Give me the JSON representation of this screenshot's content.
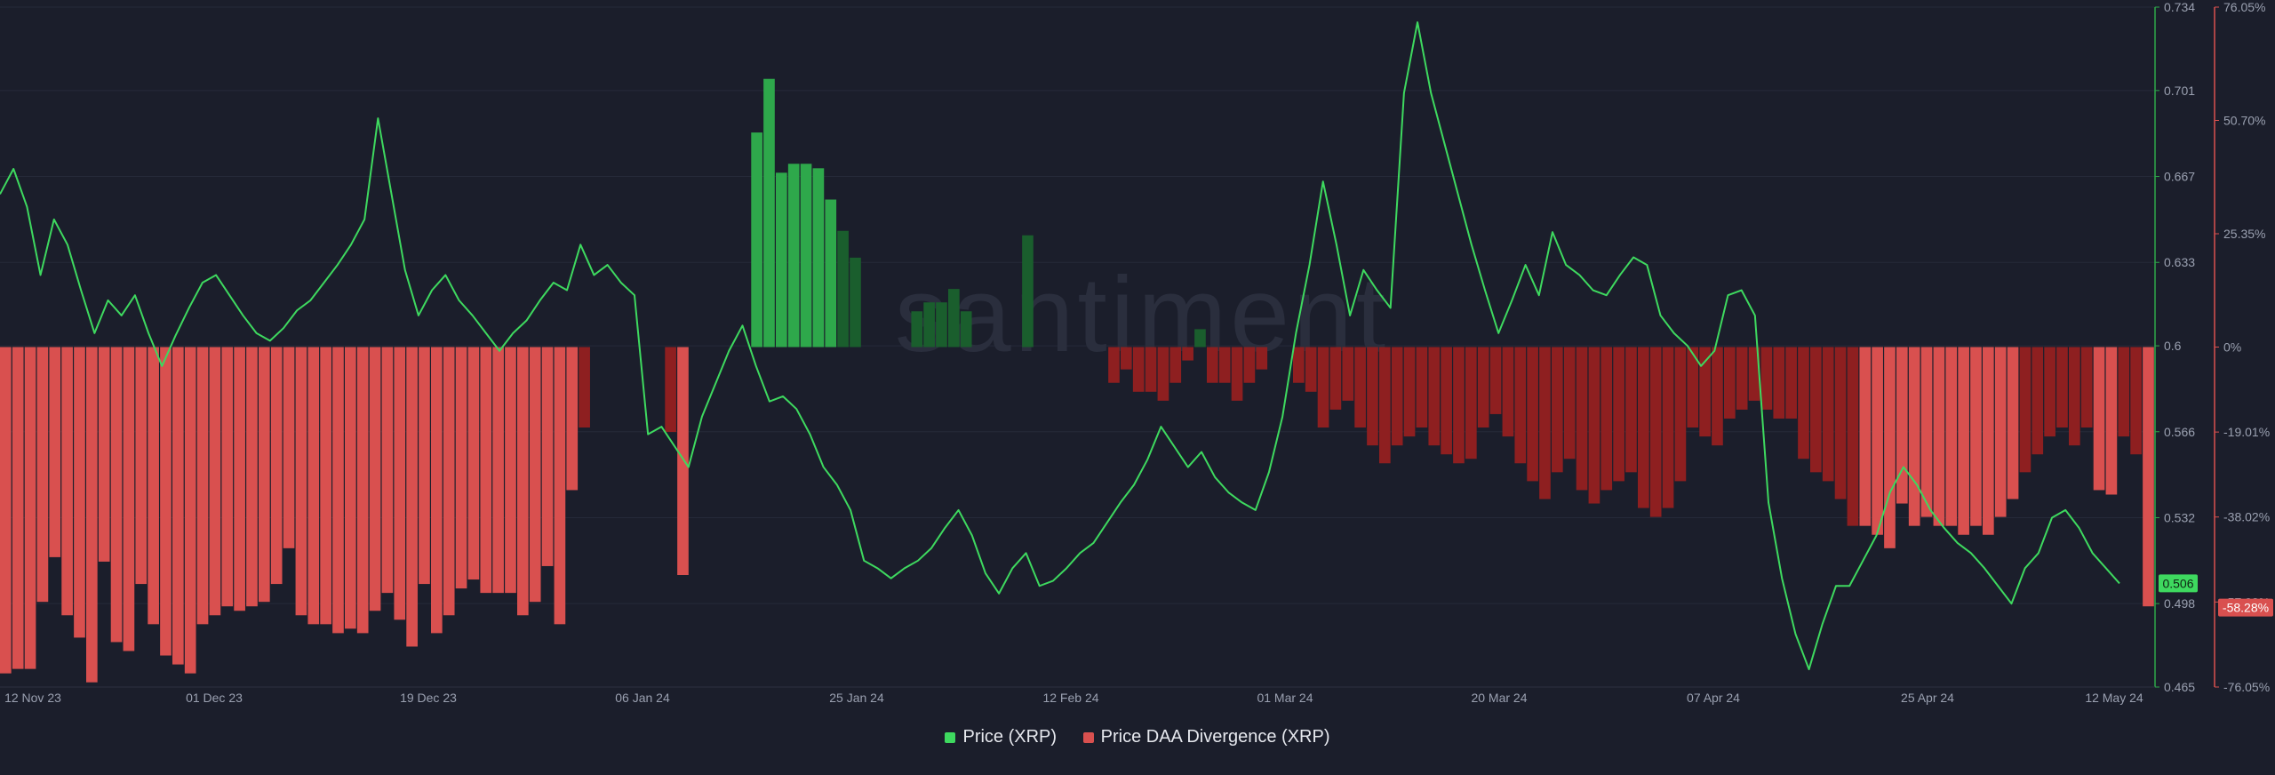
{
  "colors": {
    "background": "#1b1e2b",
    "price_line": "#3ed95f",
    "divergence_positive_bright": "#2ea84b",
    "divergence_positive_dark": "#1a5e2d",
    "divergence_negative_light": "#d9504f",
    "divergence_negative_dark": "#8e1f20",
    "price_axis_line": "#2ea84b",
    "divergence_axis_line": "#d9504f",
    "tick_text": "#9aa0b0"
  },
  "watermark": "santiment",
  "chart_data": {
    "type": "line",
    "x_tick_labels": [
      "12 Nov 23",
      "01 Dec 23",
      "19 Dec 23",
      "06 Jan 24",
      "25 Jan 24",
      "12 Feb 24",
      "01 Mar 24",
      "20 Mar 24",
      "07 Apr 24",
      "25 Apr 24",
      "12 May 24"
    ],
    "y_left_label": "",
    "price_axis": {
      "ylim": [
        0.465,
        0.734
      ],
      "tick_labels": [
        "0.734",
        "0.701",
        "0.667",
        "0.633",
        "0.6",
        "0.566",
        "0.532",
        "0.498",
        "0.465"
      ],
      "tick_values": [
        0.734,
        0.701,
        0.667,
        0.633,
        0.6,
        0.566,
        0.532,
        0.498,
        0.465
      ],
      "current_value_label": "0.506"
    },
    "divergence_axis": {
      "ylim": [
        -76.05,
        76.05
      ],
      "tick_labels": [
        "76.05%",
        "50.70%",
        "25.35%",
        "0%",
        "-19.01%",
        "-38.02%",
        "-57.03%",
        "-76.05%"
      ],
      "tick_values": [
        76.05,
        50.7,
        25.35,
        0,
        -19.01,
        -38.02,
        -57.03,
        -76.05
      ],
      "current_value_label": "-58.28%"
    },
    "series": [
      {
        "name": "Price (XRP)",
        "axis": "left",
        "x_range": [
          "12 Nov 23",
          "12 May 24"
        ],
        "values": [
          0.66,
          0.67,
          0.655,
          0.628,
          0.65,
          0.64,
          0.622,
          0.605,
          0.618,
          0.612,
          0.62,
          0.605,
          0.592,
          0.604,
          0.615,
          0.625,
          0.628,
          0.62,
          0.612,
          0.605,
          0.602,
          0.607,
          0.614,
          0.618,
          0.625,
          0.632,
          0.64,
          0.65,
          0.69,
          0.66,
          0.63,
          0.612,
          0.622,
          0.628,
          0.618,
          0.612,
          0.605,
          0.598,
          0.605,
          0.61,
          0.618,
          0.625,
          0.622,
          0.64,
          0.628,
          0.632,
          0.625,
          0.62,
          0.565,
          0.568,
          0.56,
          0.552,
          0.572,
          0.585,
          0.598,
          0.608,
          0.592,
          0.578,
          0.58,
          0.575,
          0.565,
          0.552,
          0.545,
          0.535,
          0.515,
          0.512,
          0.508,
          0.512,
          0.515,
          0.52,
          0.528,
          0.535,
          0.525,
          0.51,
          0.502,
          0.512,
          0.518,
          0.505,
          0.507,
          0.512,
          0.518,
          0.522,
          0.53,
          0.538,
          0.545,
          0.555,
          0.568,
          0.56,
          0.552,
          0.558,
          0.548,
          0.542,
          0.538,
          0.535,
          0.55,
          0.572,
          0.605,
          0.632,
          0.665,
          0.64,
          0.612,
          0.63,
          0.622,
          0.615,
          0.7,
          0.728,
          0.7,
          0.68,
          0.66,
          0.64,
          0.622,
          0.605,
          0.618,
          0.632,
          0.62,
          0.645,
          0.632,
          0.628,
          0.622,
          0.62,
          0.628,
          0.635,
          0.632,
          0.612,
          0.605,
          0.6,
          0.592,
          0.598,
          0.62,
          0.622,
          0.612,
          0.538,
          0.508,
          0.486,
          0.472,
          0.49,
          0.505,
          0.505,
          0.515,
          0.525,
          0.542,
          0.552,
          0.545,
          0.535,
          0.528,
          0.522,
          0.518,
          0.512,
          0.505,
          0.498,
          0.512,
          0.518,
          0.532,
          0.535,
          0.528,
          0.518,
          0.512,
          0.506
        ]
      },
      {
        "name": "Price DAA Divergence (XRP)",
        "axis": "right",
        "x_range": [
          "12 Nov 23",
          "12 May 24"
        ],
        "values": [
          -73,
          -72,
          -72,
          -57,
          -47,
          -60,
          -65,
          -75,
          -48,
          -66,
          -68,
          -53,
          -62,
          -69,
          -71,
          -73,
          -62,
          -60,
          -58,
          -59,
          -58,
          -57,
          -53,
          -45,
          -60,
          -62,
          -62,
          -64,
          -63,
          -64,
          -59,
          -55,
          -61,
          -67,
          -53,
          -64,
          -60,
          -54,
          -52,
          -55,
          -55,
          -55,
          -60,
          -57,
          -49,
          -62,
          -32,
          -18,
          0,
          0,
          0,
          0,
          0,
          0,
          -19,
          -51,
          0,
          0,
          0,
          0,
          0,
          48,
          60,
          39,
          41,
          41,
          40,
          33,
          26,
          20,
          0,
          0,
          0,
          0,
          8,
          10,
          10,
          13,
          8,
          0,
          0,
          0,
          0,
          25,
          0,
          0,
          0,
          0,
          0,
          0,
          -8,
          -5,
          -10,
          -10,
          -12,
          -8,
          -3,
          4,
          -8,
          -8,
          -12,
          -8,
          -5,
          0,
          0,
          -8,
          -10,
          -18,
          -14,
          -12,
          -18,
          -22,
          -26,
          -22,
          -20,
          -18,
          -22,
          -24,
          -26,
          -25,
          -18,
          -15,
          -20,
          -26,
          -30,
          -34,
          -28,
          -25,
          -32,
          -35,
          -32,
          -30,
          -28,
          -36,
          -38,
          -36,
          -30,
          -18,
          -20,
          -22,
          -16,
          -14,
          -12,
          -14,
          -16,
          -16,
          -25,
          -28,
          -30,
          -34,
          -40,
          -40,
          -42,
          -45,
          -35,
          -40,
          -38,
          -40,
          -40,
          -42,
          -40,
          -42,
          -38,
          -34,
          -28,
          -24,
          -20,
          -18,
          -22,
          -18,
          -32,
          -33,
          -20,
          -24,
          -58
        ]
      }
    ],
    "legend_position": "bottom-center",
    "grid": true
  },
  "legend": [
    {
      "label": "Price (XRP)",
      "color": "#3ed95f"
    },
    {
      "label": "Price DAA Divergence (XRP)",
      "color": "#d9504f"
    }
  ]
}
